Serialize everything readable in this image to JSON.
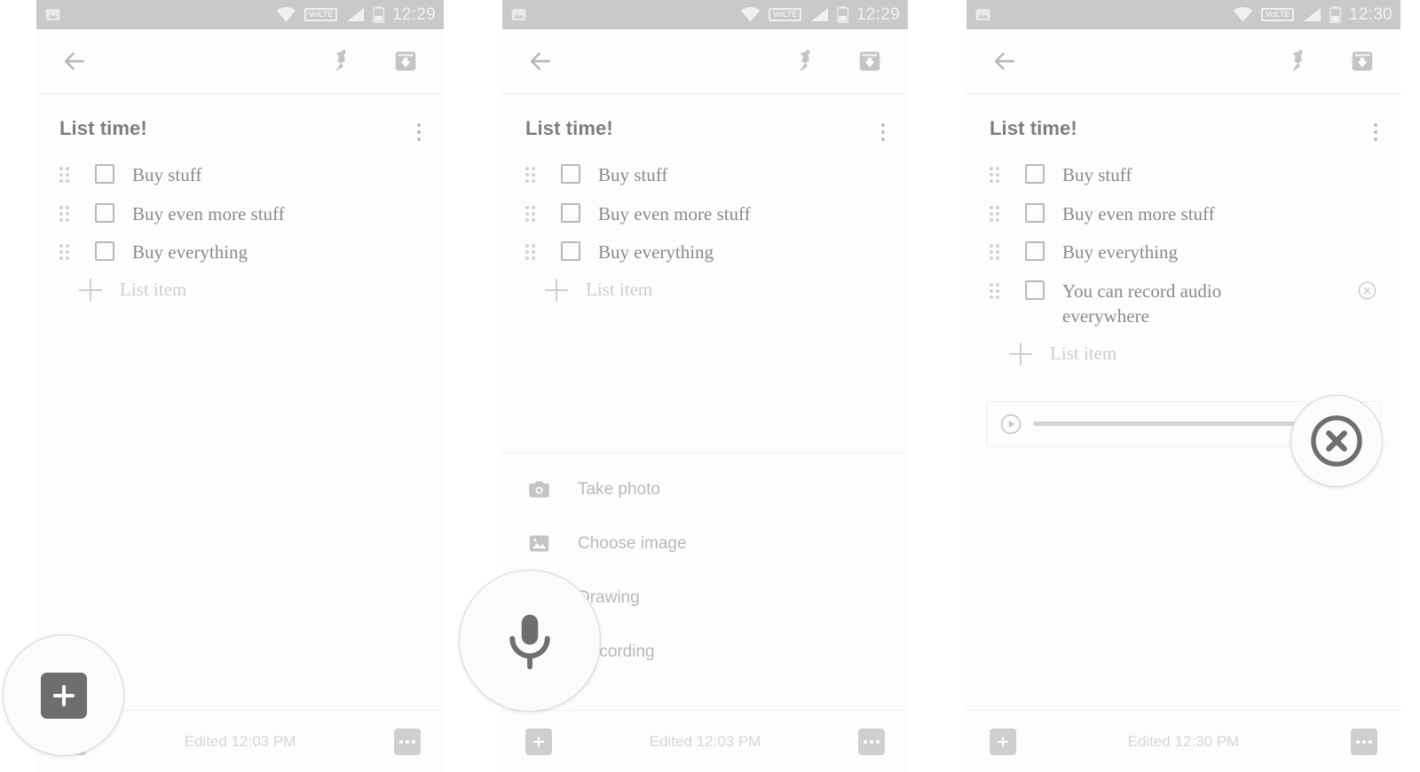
{
  "app": {
    "note_title": "List time!",
    "checklist": [
      {
        "label": "Buy stuff"
      },
      {
        "label": "Buy even more stuff"
      },
      {
        "label": "Buy everything"
      }
    ],
    "checklist_with_audio": [
      {
        "label": "Buy stuff"
      },
      {
        "label": "Buy even more stuff"
      },
      {
        "label": "Buy everything"
      },
      {
        "label": "You can record audio everywhere"
      }
    ],
    "add_item_placeholder": "List item",
    "toolbar": {
      "back_label": "Back",
      "pin_label": "Pin",
      "archive_label": "Archive"
    },
    "attach_menu": [
      {
        "label": "Take photo",
        "icon": "camera-icon"
      },
      {
        "label": "Choose image",
        "icon": "image-icon"
      },
      {
        "label": "Drawing",
        "icon": "brush-icon"
      },
      {
        "label": "Recording",
        "icon": "mic-icon"
      }
    ]
  },
  "panels": [
    {
      "id": "panel-1",
      "status": {
        "time": "12:29",
        "network_label": "VoLTE",
        "wifi": "wifi-icon",
        "signal": "signal-icon",
        "battery": "battery-icon",
        "notification": "image-notification-icon"
      },
      "footer": {
        "edited": "Edited 12:03 PM"
      },
      "highlight": "add-attachment-button"
    },
    {
      "id": "panel-2",
      "status": {
        "time": "12:29",
        "network_label": "VoLTE",
        "wifi": "wifi-icon",
        "signal": "signal-icon",
        "battery": "battery-icon",
        "notification": "image-notification-icon"
      },
      "footer": {
        "edited": "Edited 12:03 PM"
      },
      "highlight": "recording-menu-item"
    },
    {
      "id": "panel-3",
      "status": {
        "time": "12:30",
        "network_label": "VoLTE",
        "wifi": "wifi-icon",
        "signal": "signal-icon",
        "battery": "battery-icon",
        "notification": "image-notification-icon"
      },
      "footer": {
        "edited": "Edited 12:30 PM"
      },
      "highlight": "delete-recording-button",
      "audio": {
        "play_label": "Play",
        "progress_percent": 0
      }
    }
  ],
  "colors": {
    "statusbar_bg": "#c9c9c9",
    "panel_bg": "#fdfdfd",
    "text_primary": "#8a8a8a",
    "text_muted": "#cdcdcd",
    "icon_gray": "#c4c4c4",
    "accent_dark": "#6e6e6e"
  }
}
